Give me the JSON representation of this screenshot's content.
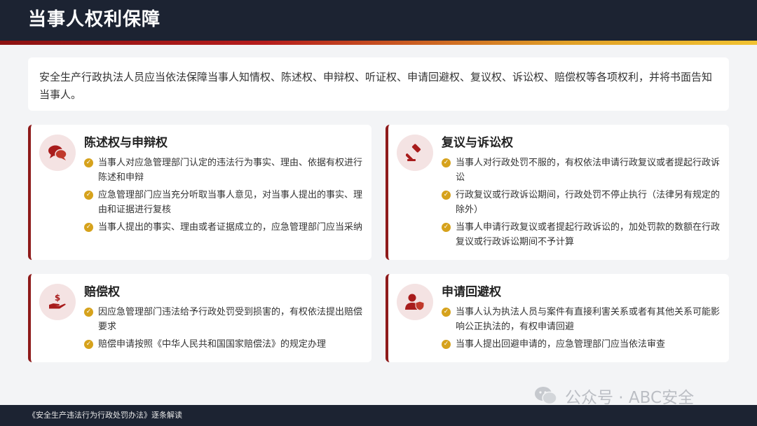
{
  "header": {
    "title": "当事人权利保障"
  },
  "intro": {
    "text": "安全生产行政执法人员应当依法保障当事人知情权、陈述权、申辩权、听证权、申请回避权、复议权、诉讼权、赔偿权等各项权利，并将书面告知当事人。"
  },
  "cards": [
    {
      "title": "陈述权与申辩权",
      "icon": "chat-bubbles-icon",
      "items": [
        "当事人对应急管理部门认定的违法行为事实、理由、依据有权进行陈述和申辩",
        "应急管理部门应当充分听取当事人意见，对当事人提出的事实、理由和证据进行复核",
        "当事人提出的事实、理由或者证据成立的，应急管理部门应当采纳"
      ]
    },
    {
      "title": "复议与诉讼权",
      "icon": "gavel-icon",
      "items": [
        "当事人对行政处罚不服的，有权依法申请行政复议或者提起行政诉讼",
        "行政复议或行政诉讼期间，行政处罚不停止执行（法律另有规定的除外）",
        "当事人申请行政复议或者提起行政诉讼的，加处罚款的数额在行政复议或行政诉讼期间不予计算"
      ]
    },
    {
      "title": "赔偿权",
      "icon": "hand-money-icon",
      "items": [
        "因应急管理部门违法给予行政处罚受到损害的，有权依法提出赔偿要求",
        "赔偿申请按照《中华人民共和国国家赔偿法》的规定办理"
      ]
    },
    {
      "title": "申请回避权",
      "icon": "user-shield-icon",
      "items": [
        "当事人认为执法人员与案件有直接利害关系或者有其他关系可能影响公正执法的，有权申请回避",
        "当事人提出回避申请的，应急管理部门应当依法审查"
      ]
    }
  ],
  "footer": {
    "text": "《安全生产违法行为行政处罚办法》逐条解读"
  },
  "watermark": {
    "text": "公众号 · ABC安全"
  },
  "colors": {
    "accent": "#8e1a1a",
    "check": "#d6a21c",
    "header_bg": "#1c2332"
  }
}
